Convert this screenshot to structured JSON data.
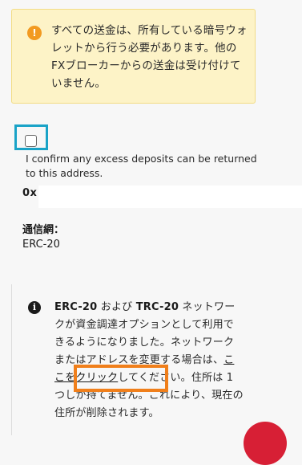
{
  "warning": {
    "icon": "exclamation-icon",
    "icon_glyph": "!",
    "text": "すべての送金は、所有している暗号ウォレットから行う必要があります。他のFXブローカーからの送金は受け付けていません。"
  },
  "confirm": {
    "label": "I confirm any excess deposits can be returned to this address.",
    "checked": false
  },
  "address": {
    "visible_prefix": "0x"
  },
  "network": {
    "label": "通信網：",
    "value": "ERC-20"
  },
  "info": {
    "icon": "info-icon",
    "icon_glyph": "i",
    "erc": "ERC-20",
    "and": " および ",
    "trc": "TRC-20",
    "text_before_link": " ネットワークが資金調達オプションとして利用できるようになりました。ネットワークまたはアドレスを変更する場合は、",
    "link_text": "ここをクリック",
    "text_after_link": "してください。住所は 1 つしか持てません。これにより、現在の住所が削除されます。"
  },
  "colors": {
    "warning_bg": "#fdf3c7",
    "warning_icon": "#f29a21",
    "checkbox_highlight": "#1aa3c7",
    "link_highlight": "#f07f1b",
    "chat_button": "#d71f35"
  }
}
